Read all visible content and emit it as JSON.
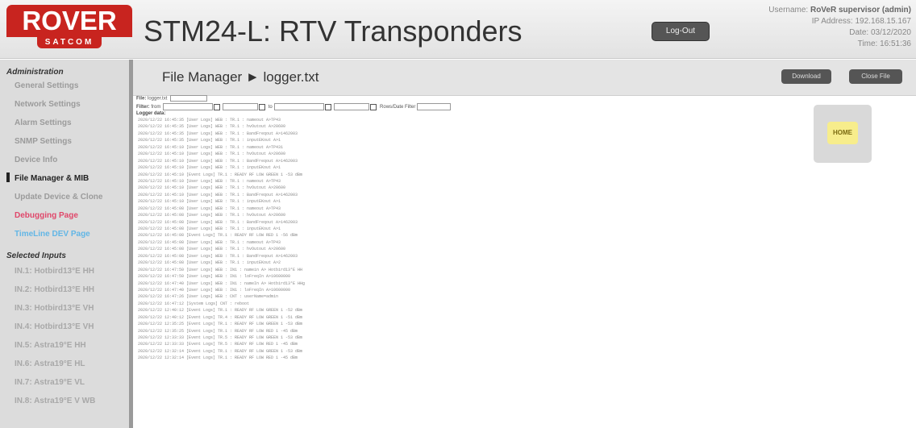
{
  "header": {
    "logo_text": "ROVER",
    "logo_sub": "SATCOM",
    "app_title": "STM24-L: RTV Transponders",
    "logout_label": "Log-Out",
    "username_label": "Username:",
    "username_value": "RoVeR supervisor (admin)",
    "ip_label": "IP Address: 192.168.15.167",
    "date_label": "Date: 03/12/2020",
    "time_label": "Time: 16:51:36"
  },
  "sidebar": {
    "admin_title": "Administration",
    "items": [
      {
        "label": "General Settings"
      },
      {
        "label": "Network Settings"
      },
      {
        "label": "Alarm Settings"
      },
      {
        "label": "SNMP Settings"
      },
      {
        "label": "Device Info"
      },
      {
        "label": "File Manager & MIB"
      },
      {
        "label": "Update Device & Clone"
      },
      {
        "label": "Debugging Page"
      },
      {
        "label": "TimeLine DEV Page"
      }
    ],
    "inputs_title": "Selected Inputs",
    "inputs": [
      {
        "label": "IN.1: Hotbird13°E HH"
      },
      {
        "label": "IN.2: Hotbird13°E HH"
      },
      {
        "label": "IN.3: Hotbird13°E VH"
      },
      {
        "label": "IN.4: Hotbird13°E VH"
      },
      {
        "label": "IN.5: Astra19°E HH"
      },
      {
        "label": "IN.6: Astra19°E HL"
      },
      {
        "label": "IN.7: Astra19°E VL"
      },
      {
        "label": "IN.8: Astra19°E V WB"
      }
    ]
  },
  "main": {
    "page_title": "File Manager ► logger.txt",
    "download_label": "Download",
    "close_label": "Close File",
    "file_label": "File:",
    "file_value": "logger.txt",
    "filter_label": "Filter:",
    "from_label": "from",
    "to_label": "to",
    "rows_label": "Rows/Date Filter",
    "logger_label": "Logger data:",
    "home_label": "HOME"
  },
  "log_lines": [
    "2020/12/22 16:45:35 [User Logs]  WEB : TR.1 : nameout A>TP43",
    "2020/12/22 16:45:35 [User Logs]  WEB : TR.1 : hvOutout A>20600",
    "2020/12/22 16:45:35 [User Logs]  WEB : TR.1 : BandFreqout A>1462003",
    "2020/12/22 16:45:35 [User Logs]  WEB : TR.1 : inputEKout A>1",
    "2020/12/22 16:45:10 [User Logs]  WEB : TR.1 : nameout A>TP431",
    "2020/12/22 16:45:10 [User Logs]  WEB : TR.1 : hvOutout A>20600",
    "2020/12/22 16:45:10 [User Logs]  WEB : TR.1 : BandFreqout A>1462003",
    "2020/12/22 16:45:10 [User Logs]  WEB : TR.1 : inputEKout A>1",
    "2020/12/22 16:45:10 [Event Logs]  TR.1 : READY  RF LOW  GREEN  1  -53 dBm",
    "2020/12/22 16:45:10 [User Logs]  WEB : TR.1 : nameout A>TP43",
    "2020/12/22 16:45:10 [User Logs]  WEB : TR.1 : hvOutout A>20600",
    "2020/12/22 16:45:10 [User Logs]  WEB : TR.1 : BandFreqout A>1462003",
    "2020/12/22 16:45:10 [User Logs]  WEB : TR.1 : inputEKout A>1",
    "2020/12/22 16:45:08 [User Logs]  WEB : TR.1 : nameout A>TP43",
    "2020/12/22 16:45:08 [User Logs]  WEB : TR.1 : hvOutout A>20600",
    "2020/12/22 16:45:08 [User Logs]  WEB : TR.1 : BandFreqout A>1462003",
    "2020/12/22 16:45:08 [User Logs]  WEB : TR.1 : inputEKout A>1",
    "2020/12/22 16:45:08 [Event Logs]  TR.1 : READY  RF LOW  RED  1  -56 dBm",
    "2020/12/22 16:45:08 [User Logs]  WEB : TR.1 : nameout A>TP43",
    "2020/12/22 16:45:08 [User Logs]  WEB : TR.1 : hvOutout A>20600",
    "2020/12/22 16:45:08 [User Logs]  WEB : TR.1 : BandFreqout A>1462003",
    "2020/12/22 16:45:08 [User Logs]  WEB : TR.1 : inputEKout A>2",
    "2020/12/22 16:47:50 [User Logs]  WEB : IN1 : namein A> Hotbird13°E HH",
    "2020/12/22 16:47:50 [User Logs]  WEB : IN1 : loFreqIn A>10600000",
    "2020/12/22 16:47:40 [User Logs]  WEB : IN1 : nameIn A> Hotbird13°E HHg",
    "2020/12/22 16:47:40 [User Logs]  WEB : IN1 : loFreqIn A>10600000",
    "2020/12/22 16:47:26 [User Logs]  WEB : CNT : userName=admin",
    "2020/12/22 16:47:12 [System Logs]  CNT : reboot",
    "2020/12/22 12:40:12 [Event Logs]  TR.1 : READY  RF LOW  GREEN  1  -52 dBm",
    "2020/12/22 12:40:12 [Event Logs]  TR.4 : READY  RF LOW  GREEN  1  -51 dBm",
    "2020/12/22 12:35:25 [Event Logs]  TR.1 : READY  RF LOW  GREEN  1  -53 dBm",
    "2020/12/22 12:35:25 [Event Logs]  TR.1 : READY  RF LOW  RED  1  -45 dBm",
    "2020/12/22 12:33:33 [Event Logs]  TR.5 : READY  RF LOW  GREEN  1  -53 dBm",
    "2020/12/22 12:33:33 [Event Logs]  TR.5 : READY  RF LOW  RED  1  -45 dBm",
    "2020/12/22 12:32:14 [Event Logs]  TR.1 : READY  RF LOW  GREEN  1  -53 dBm",
    "2020/12/22 12:32:14 [Event Logs]  TR.1 : READY  RF LOW  RED  1  -45 dBm"
  ]
}
